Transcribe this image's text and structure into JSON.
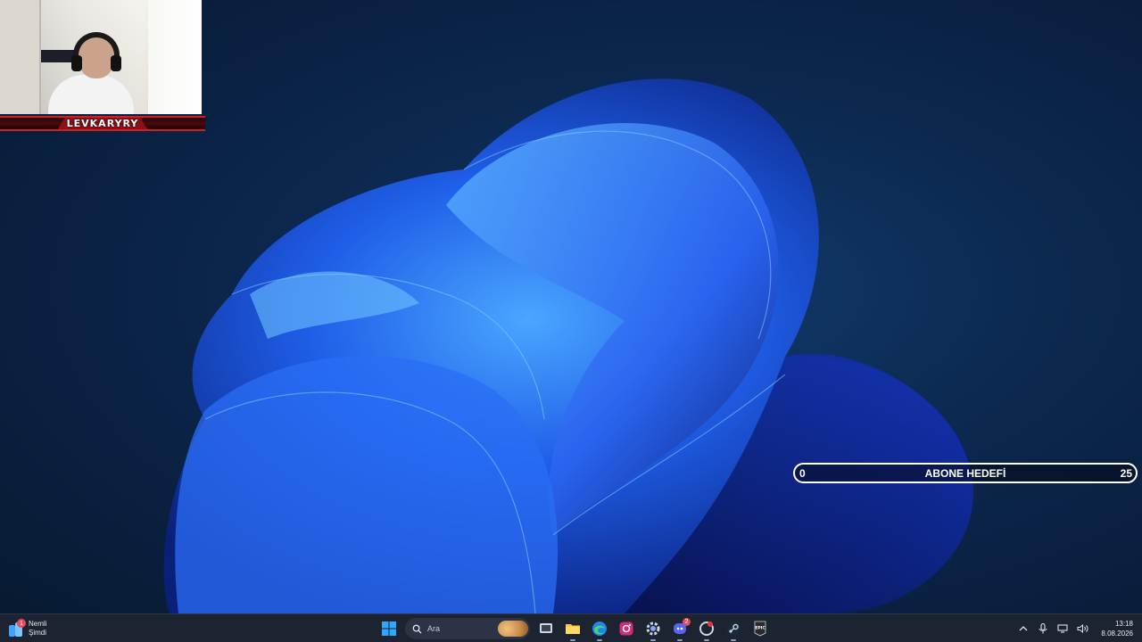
{
  "webcam": {
    "streamer_name": "LEVKARYRY"
  },
  "subscriber_goal": {
    "label": "ABONE HEDEFİ",
    "current": "0",
    "target": "25"
  },
  "taskbar": {
    "widget": {
      "title": "Nemli",
      "subtitle": "Şimdi",
      "badge": "1"
    },
    "search": {
      "placeholder": "Ara"
    },
    "apps": [
      {
        "name": "start",
        "icon": "windows-icon"
      },
      {
        "name": "task-view",
        "icon": "task-view-icon"
      },
      {
        "name": "file-explorer",
        "icon": "folder-icon"
      },
      {
        "name": "edge",
        "icon": "edge-icon"
      },
      {
        "name": "instagram",
        "icon": "instagram-icon"
      },
      {
        "name": "settings",
        "icon": "gear-icon"
      },
      {
        "name": "discord",
        "icon": "discord-icon",
        "badge": "2"
      },
      {
        "name": "app-red",
        "icon": "red-app-icon"
      },
      {
        "name": "steam",
        "icon": "steam-icon"
      },
      {
        "name": "epic",
        "icon": "epic-games-icon",
        "label": "EPIC"
      }
    ],
    "tray": {
      "time": "13:18",
      "date": "8.08.2026"
    }
  },
  "colors": {
    "accent_red": "#d21d25",
    "taskbar_bg": "#1c2331",
    "desktop_bg": "#0c2a52"
  }
}
